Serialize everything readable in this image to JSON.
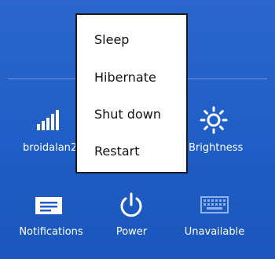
{
  "settings_tiles": {
    "network": {
      "label": "broidalan2",
      "icon": "signal-bars-icon"
    },
    "brightness": {
      "label": "Brightness",
      "icon": "sun-icon"
    },
    "notifications": {
      "label": "Notifications",
      "icon": "notifications-icon"
    },
    "power": {
      "label": "Power",
      "icon": "power-icon"
    },
    "keyboard": {
      "label": "Unavailable",
      "icon": "keyboard-icon"
    }
  },
  "power_menu": {
    "items": [
      {
        "label": "Sleep"
      },
      {
        "label": "Hibernate"
      },
      {
        "label": "Shut down"
      },
      {
        "label": "Restart"
      }
    ]
  },
  "colors": {
    "background": "#1f5ec6",
    "menu_background": "#ffffff",
    "menu_border": "#1a1a1a"
  }
}
